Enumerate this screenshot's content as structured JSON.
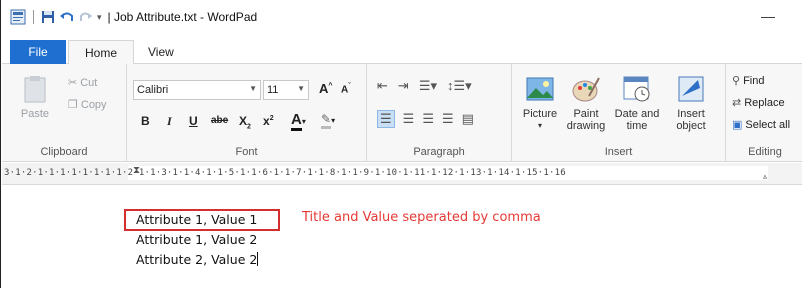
{
  "titlebar": {
    "title": "| Job Attribute.txt - WordPad",
    "minimize": "—"
  },
  "tabs": [
    {
      "label": "File"
    },
    {
      "label": "Home"
    },
    {
      "label": "View"
    }
  ],
  "clipboard": {
    "paste": "Paste",
    "cut": "Cut",
    "copy": "Copy",
    "group": "Clipboard"
  },
  "font": {
    "family": "Calibri",
    "size": "11",
    "grow": "A",
    "shrink": "A",
    "bold": "B",
    "italic": "I",
    "underline": "U",
    "strike": "abe",
    "subscript": "X",
    "superscript": "x",
    "color": "A",
    "group": "Font"
  },
  "paragraph": {
    "group": "Paragraph"
  },
  "insert": {
    "picture": "Picture",
    "paint_1": "Paint",
    "paint_2": "drawing",
    "datetime_1": "Date and",
    "datetime_2": "time",
    "object_1": "Insert",
    "object_2": "object",
    "group": "Insert"
  },
  "editing": {
    "find": "Find",
    "replace": "Replace",
    "select_all": "Select all",
    "group": "Editing"
  },
  "ruler": {
    "ticks": "3·1·2·1·1·1·1·1·1·1·1·2·1·1·3·1·1·4·1·1·5·1·1·6·1·1·7·1·1·8·1·1·9·1·10·1·11·1·12·1·13·1·14·1·15·1·16"
  },
  "document": {
    "lines": [
      "Attribute 1, Value 1",
      "Attribute 1, Value 2",
      "Attribute 2, Value 2"
    ],
    "annotation": "Title and Value seperated by comma"
  },
  "colors": {
    "file_tab": "#1f6fd0",
    "annotation": "#e53935",
    "highlight_border": "#d32f2f"
  }
}
